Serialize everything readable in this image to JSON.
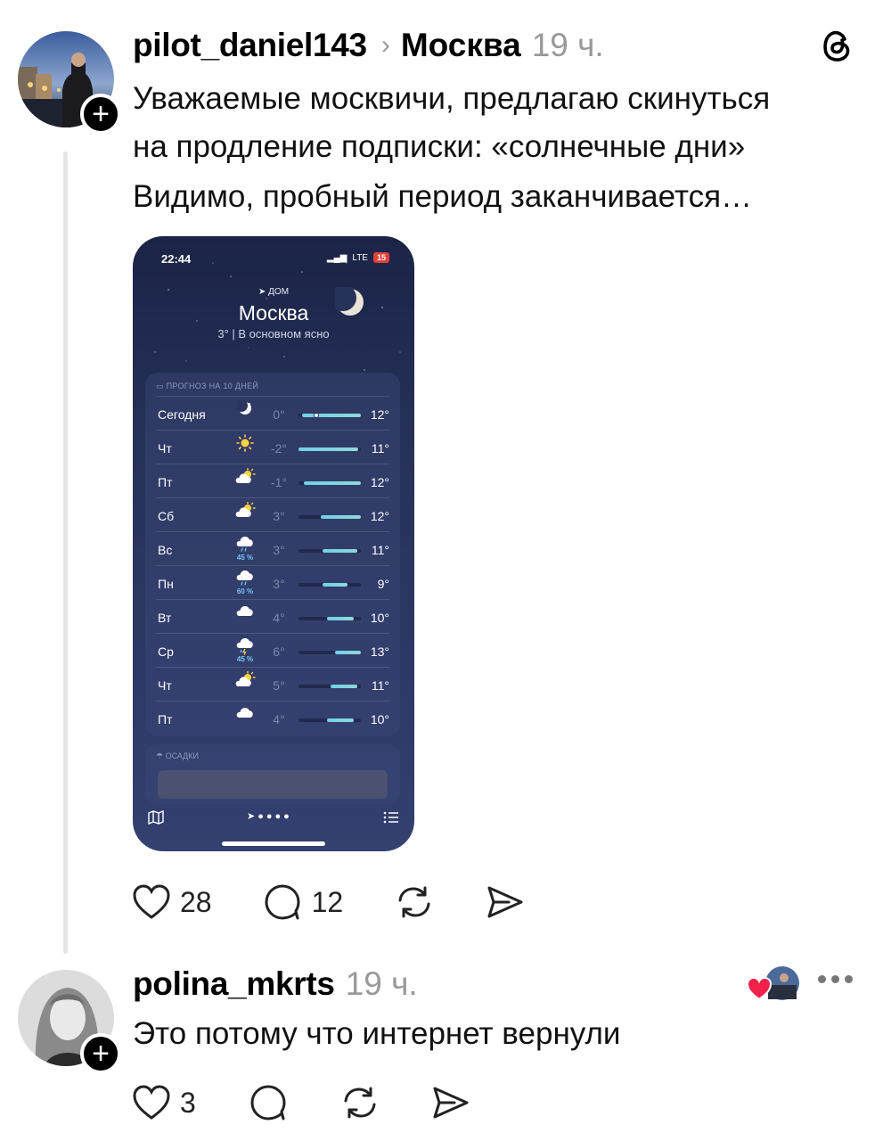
{
  "post": {
    "author": "pilot_daniel143",
    "separator": "›",
    "location": "Москва",
    "time": "19 ч.",
    "text_lines": [
      "Уважаемые москвичи, предлагаю скинуться",
      "на продление подписки: «солнечные дни»",
      "Видимо, пробный период заканчивается…"
    ],
    "likes": "28",
    "comments": "12"
  },
  "weather_screenshot": {
    "status_time": "22:44",
    "network": "LTE",
    "battery": "15",
    "location_label": "ДОМ",
    "city": "Москва",
    "condition": "3° | В основном ясно",
    "forecast_title": "ПРОГНОЗ НА 10 ДНЕЙ",
    "precip_title": "ОСАДКИ",
    "days": [
      {
        "day": "Сегодня",
        "icon": "moon-icon",
        "pct": "",
        "lo": "0°",
        "hi": "12°",
        "from": 0.05,
        "to": 1.0
      },
      {
        "day": "Чт",
        "icon": "sun-icon",
        "pct": "",
        "lo": "-2°",
        "hi": "11°",
        "from": 0.0,
        "to": 0.95
      },
      {
        "day": "Пт",
        "icon": "partly-sunny-icon",
        "pct": "",
        "lo": "-1°",
        "hi": "12°",
        "from": 0.08,
        "to": 1.0
      },
      {
        "day": "Сб",
        "icon": "partly-sunny-icon",
        "pct": "",
        "lo": "3°",
        "hi": "12°",
        "from": 0.35,
        "to": 1.0
      },
      {
        "day": "Вс",
        "icon": "rain-cloud-icon",
        "pct": "45 %",
        "lo": "3°",
        "hi": "11°",
        "from": 0.38,
        "to": 0.95
      },
      {
        "day": "Пн",
        "icon": "rain-cloud-icon",
        "pct": "60 %",
        "lo": "3°",
        "hi": "9°",
        "from": 0.38,
        "to": 0.78
      },
      {
        "day": "Вт",
        "icon": "cloud-icon",
        "pct": "",
        "lo": "4°",
        "hi": "10°",
        "from": 0.45,
        "to": 0.88
      },
      {
        "day": "Ср",
        "icon": "thunder-cloud-icon",
        "pct": "45 %",
        "lo": "6°",
        "hi": "13°",
        "from": 0.58,
        "to": 1.05
      },
      {
        "day": "Чт",
        "icon": "partly-sunny-icon",
        "pct": "",
        "lo": "5°",
        "hi": "11°",
        "from": 0.52,
        "to": 0.95
      },
      {
        "day": "Пт",
        "icon": "cloud-icon",
        "pct": "",
        "lo": "4°",
        "hi": "10°",
        "from": 0.45,
        "to": 0.88
      }
    ]
  },
  "reply": {
    "author": "polina_mkrts",
    "time": "19 ч.",
    "text": "Это потому что интернет вернули",
    "likes": "3"
  },
  "colors": {
    "like_heart": "#f0214b",
    "secondary_text": "#999999",
    "thread_line": "#e6e6e6"
  }
}
